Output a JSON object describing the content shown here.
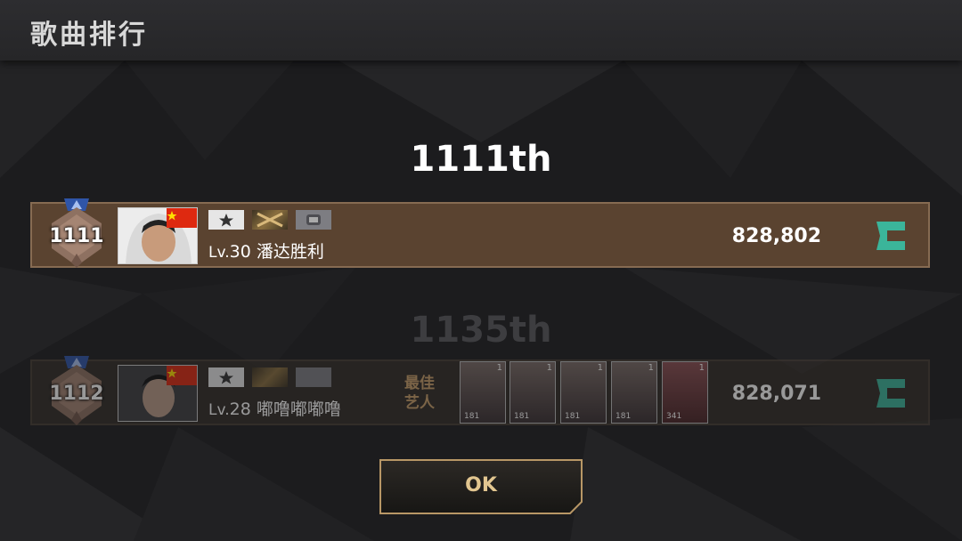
{
  "header": {
    "title": "歌曲排行"
  },
  "current_rank": {
    "rank_label": "1111th",
    "medal_number": "1111",
    "level_prefix": "Lv.",
    "level": "30",
    "player_name": "潘达胜利",
    "score": "828,802",
    "flag": "china-flag-icon",
    "accent_color": "#3bb59a"
  },
  "next_rank": {
    "rank_label": "1135th",
    "medal_number": "1112",
    "level_prefix": "Lv.",
    "level": "28",
    "player_name": "嘟噜嘟嘟噜",
    "score": "828,071",
    "best_artist_line1": "最佳",
    "best_artist_line2": "艺人",
    "cards": [
      {
        "level": "1",
        "value": "181"
      },
      {
        "level": "1",
        "value": "181"
      },
      {
        "level": "1",
        "value": "181"
      },
      {
        "level": "1",
        "value": "181"
      },
      {
        "level": "1",
        "value": "341"
      }
    ]
  },
  "ok_button": {
    "label": "OK"
  },
  "colors": {
    "row_current": "#5a4330",
    "row_border": "#866b52",
    "ok_text": "#e2c690",
    "rank_icon": "#3bb59a"
  }
}
